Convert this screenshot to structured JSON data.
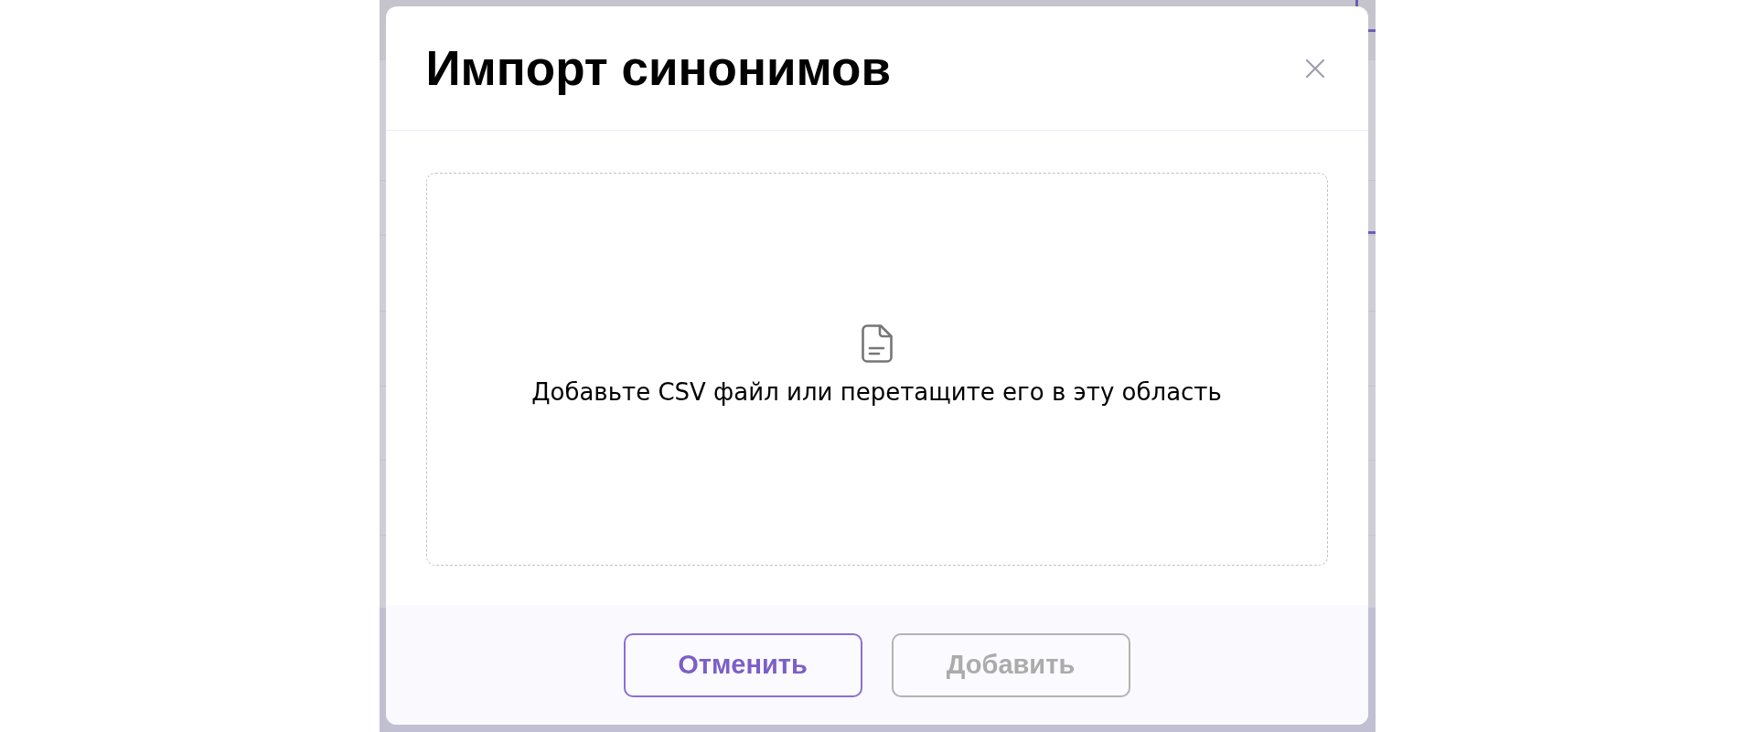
{
  "dialog": {
    "title": "Импорт синонимов"
  },
  "dropzone": {
    "prompt": "Добавьте CSV файл или перетащите его в эту область"
  },
  "buttons": [
    {
      "label": "Отменить",
      "kind": "secondary",
      "disabled": false
    },
    {
      "label": "Добавить",
      "kind": "primary",
      "disabled": true
    }
  ]
}
